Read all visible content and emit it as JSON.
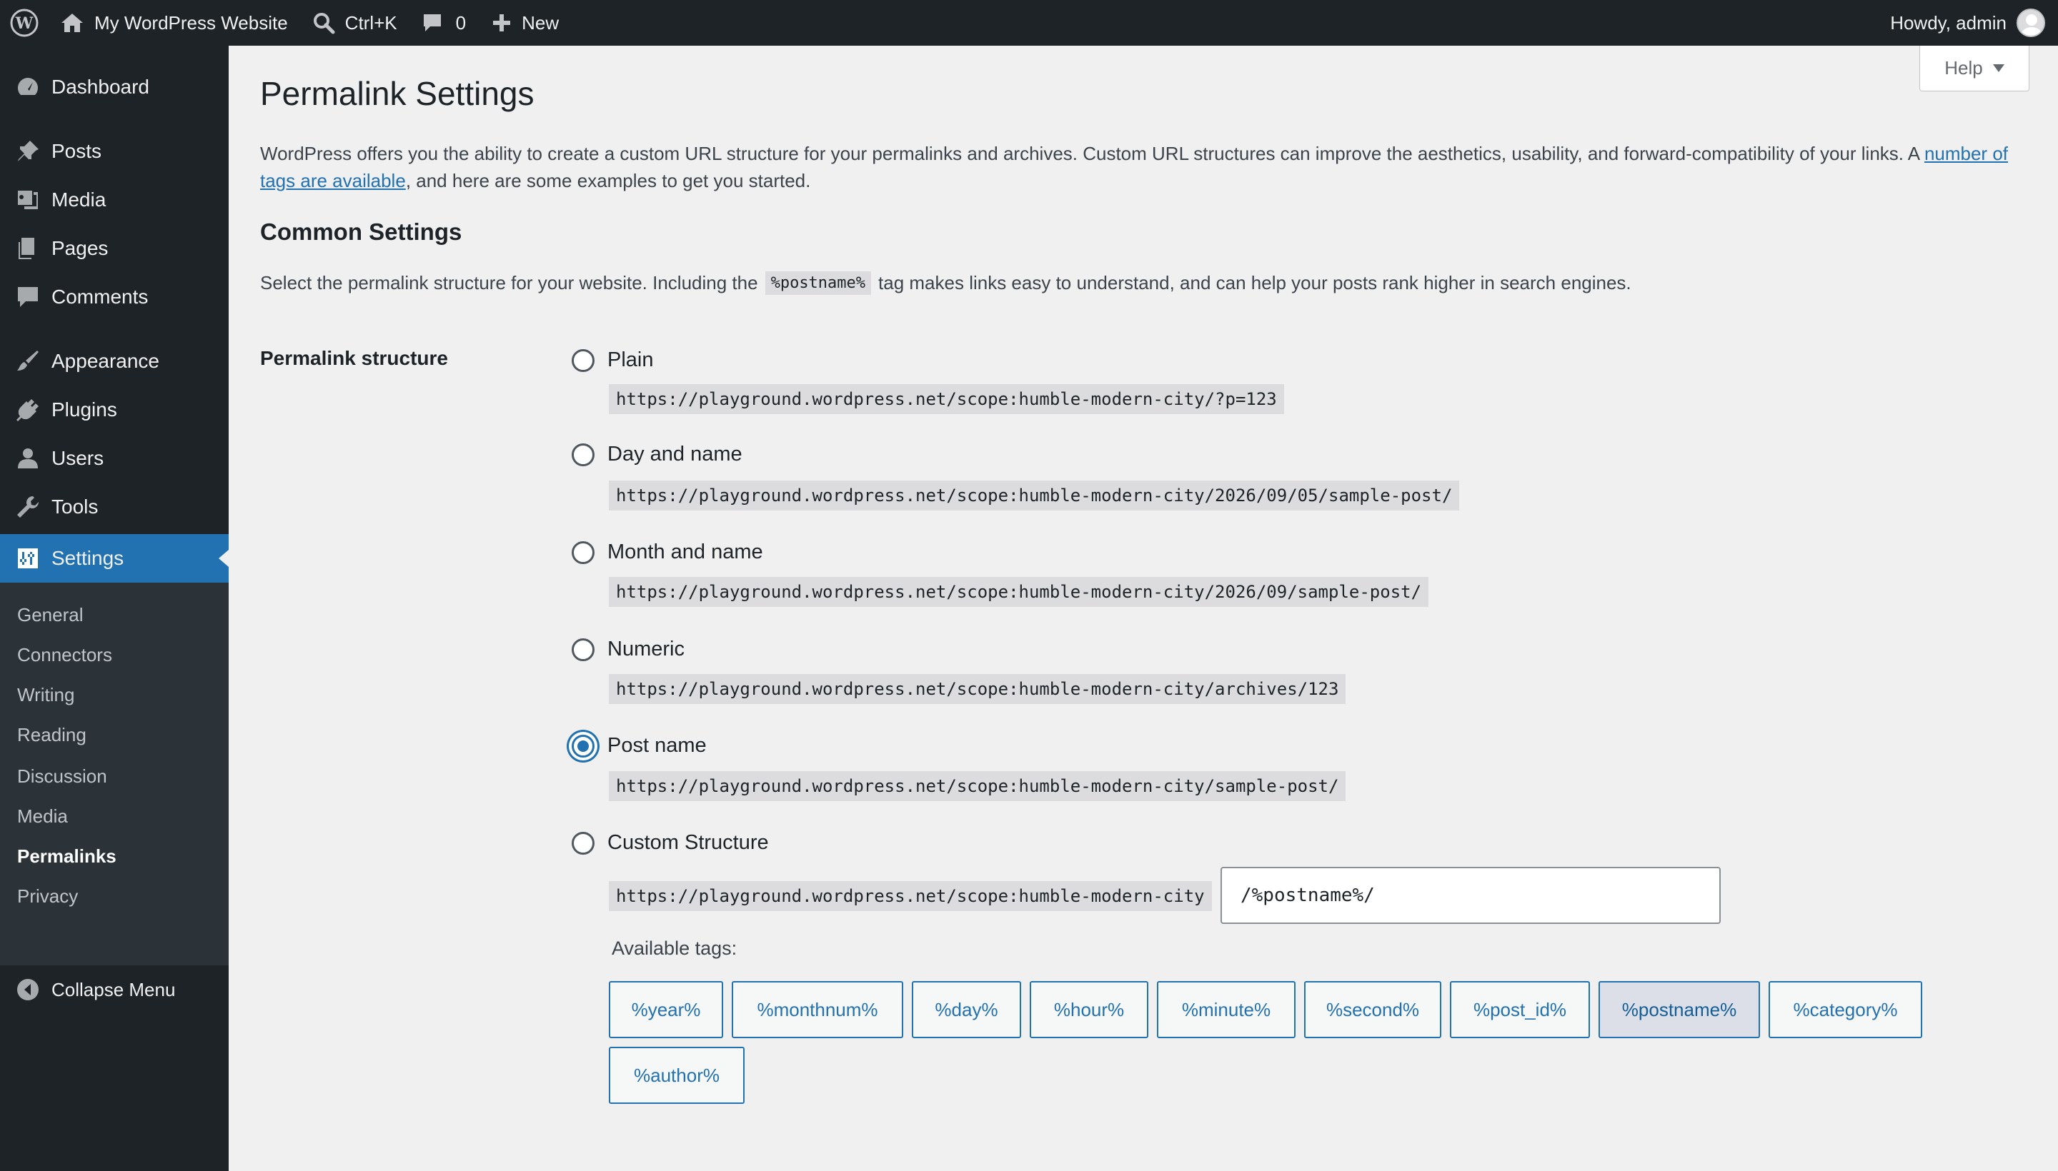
{
  "adminbar": {
    "site_name": "My WordPress Website",
    "search_label": "Ctrl+K",
    "comments_count": "0",
    "new_label": "New",
    "howdy": "Howdy, admin"
  },
  "sidebar": {
    "items": [
      {
        "label": "Dashboard",
        "icon": "dashboard-icon"
      },
      {
        "label": "Posts",
        "icon": "pin-icon"
      },
      {
        "label": "Media",
        "icon": "media-icon"
      },
      {
        "label": "Pages",
        "icon": "pages-icon"
      },
      {
        "label": "Comments",
        "icon": "comment-icon"
      },
      {
        "label": "Appearance",
        "icon": "brush-icon"
      },
      {
        "label": "Plugins",
        "icon": "plug-icon"
      },
      {
        "label": "Users",
        "icon": "user-icon"
      },
      {
        "label": "Tools",
        "icon": "wrench-icon"
      },
      {
        "label": "Settings",
        "icon": "settings-icon"
      }
    ],
    "submenu": [
      "General",
      "Connectors",
      "Writing",
      "Reading",
      "Discussion",
      "Media",
      "Permalinks",
      "Privacy"
    ],
    "collapse_label": "Collapse Menu"
  },
  "help": {
    "label": "Help"
  },
  "page": {
    "title": "Permalink Settings",
    "intro_text": "WordPress offers you the ability to create a custom URL structure for your permalinks and archives. Custom URL structures can improve the aesthetics, usability, and forward-compatibility of your links. A ",
    "intro_link": "number of tags are available",
    "intro_tail": ", and here are some examples to get you started.",
    "common_title": "Common Settings",
    "common_desc_before": "Select the permalink structure for your website. Including the",
    "common_desc_tag": "%postname%",
    "common_desc_after": "tag makes links easy to understand, and can help your posts rank higher in search engines.",
    "field_label": "Permalink structure"
  },
  "options": [
    {
      "label": "Plain",
      "url": "https://playground.wordpress.net/scope:humble-modern-city/?p=123",
      "checked": false
    },
    {
      "label": "Day and name",
      "url": "https://playground.wordpress.net/scope:humble-modern-city/2026/09/05/sample-post/",
      "checked": false
    },
    {
      "label": "Month and name",
      "url": "https://playground.wordpress.net/scope:humble-modern-city/2026/09/sample-post/",
      "checked": false
    },
    {
      "label": "Numeric",
      "url": "https://playground.wordpress.net/scope:humble-modern-city/archives/123",
      "checked": false
    },
    {
      "label": "Post name",
      "url": "https://playground.wordpress.net/scope:humble-modern-city/sample-post/",
      "checked": true
    },
    {
      "label": "Custom Structure",
      "url": "https://playground.wordpress.net/scope:humble-modern-city",
      "checked": false
    }
  ],
  "custom_structure_value": "/%postname%/",
  "available_tags_label": "Available tags:",
  "tags": [
    "%year%",
    "%monthnum%",
    "%day%",
    "%hour%",
    "%minute%",
    "%second%",
    "%post_id%",
    "%postname%",
    "%category%",
    "%author%"
  ],
  "active_tag": "%postname%",
  "colors": {
    "accent": "#2271b1",
    "adminbar": "#1d2327",
    "background": "#f0f0f1"
  }
}
